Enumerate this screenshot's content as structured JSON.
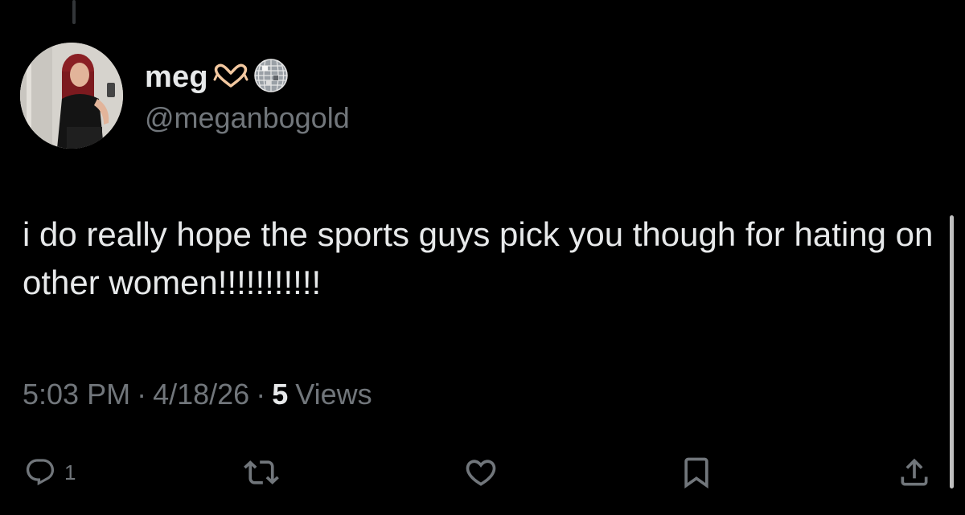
{
  "author": {
    "display_name": "meg",
    "handle": "@meganbogold"
  },
  "tweet": {
    "text": "i do really hope the sports guys pick you though for hating on other women!!!!!!!!!!!"
  },
  "meta": {
    "time": "5:03 PM",
    "separator": "·",
    "date": "4/18/26",
    "views_count": "5",
    "views_label": "Views"
  },
  "actions": {
    "reply_count": "1"
  },
  "icons": {
    "reply": "reply-icon",
    "retweet": "retweet-icon",
    "like": "heart-icon",
    "bookmark": "bookmark-icon",
    "share": "share-icon",
    "emoji_1": "heart-hands-emoji",
    "emoji_2": "mirror-ball-emoji"
  },
  "colors": {
    "background": "#000000",
    "primary_text": "#e7e9ea",
    "secondary_text": "#71767b"
  }
}
